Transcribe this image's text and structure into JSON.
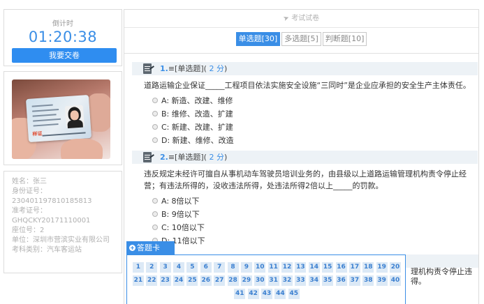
{
  "timer": {
    "label": "倒计时",
    "value": "01:20:38",
    "submit_label": "我要交卷"
  },
  "photo": {
    "card_stamp": "样证"
  },
  "candidate": {
    "name": "姓名：张三",
    "id_label": "身份证号：",
    "id_value": "230401197810185813",
    "exam_no_label": "准考证号：",
    "exam_no_value": "GHQCKY20171110001",
    "seat": "座位号：2",
    "unit": "单位：深圳市营滨实业有限公司",
    "category": "考科类别：汽车客运站"
  },
  "paper": {
    "header": "考试试卷",
    "tabs": [
      {
        "label": "单选题[30]",
        "active": true
      },
      {
        "label": "多选题[5]",
        "active": false
      },
      {
        "label": "判断题[10]",
        "active": false
      }
    ]
  },
  "questions": [
    {
      "number": "1.",
      "type": "≡[单选题]",
      "points_open": "(",
      "points": "2 分",
      "points_close": ")",
      "stem": "道路运输企业保证_____工程项目依法实施安全设施“三同时”是企业应承担的安全生产主体责任。",
      "options": [
        "A: 新造、改建、维修",
        "B: 维修、改造、扩建",
        "C: 新建、改建、扩建",
        "D: 新建、维修、改造"
      ]
    },
    {
      "number": "2.",
      "type": "≡[单选题]",
      "points_open": "(",
      "points": "2 分",
      "points_close": ")",
      "stem": "违反规定未经许可擅自从事机动车驾驶员培训业务的，由县级以上道路运输管理机构责令停止经营；有违法所得的，没收违法所得，处违法所得2倍以上_____的罚款。",
      "options": [
        "A: 8倍以下",
        "B: 9倍以下",
        "C: 10倍以下",
        "D: 11倍以下"
      ]
    },
    {
      "stem_tail": "理机构责令停止违得。"
    }
  ],
  "answer_card": {
    "label": "答题卡",
    "numbers": [
      "1",
      "2",
      "3",
      "4",
      "5",
      "6",
      "7",
      "8",
      "9",
      "10",
      "11",
      "12",
      "13",
      "14",
      "15",
      "16",
      "17",
      "18",
      "19",
      "20",
      "21",
      "22",
      "23",
      "24",
      "25",
      "26",
      "27",
      "28",
      "29",
      "30",
      "31",
      "32",
      "33",
      "34",
      "35",
      "36",
      "37",
      "38",
      "39",
      "40",
      "41",
      "42",
      "43",
      "44",
      "45"
    ]
  },
  "colors": {
    "accent": "#3a8ee6",
    "submit": "#2f8df0",
    "muted": "#b0b0b0"
  }
}
